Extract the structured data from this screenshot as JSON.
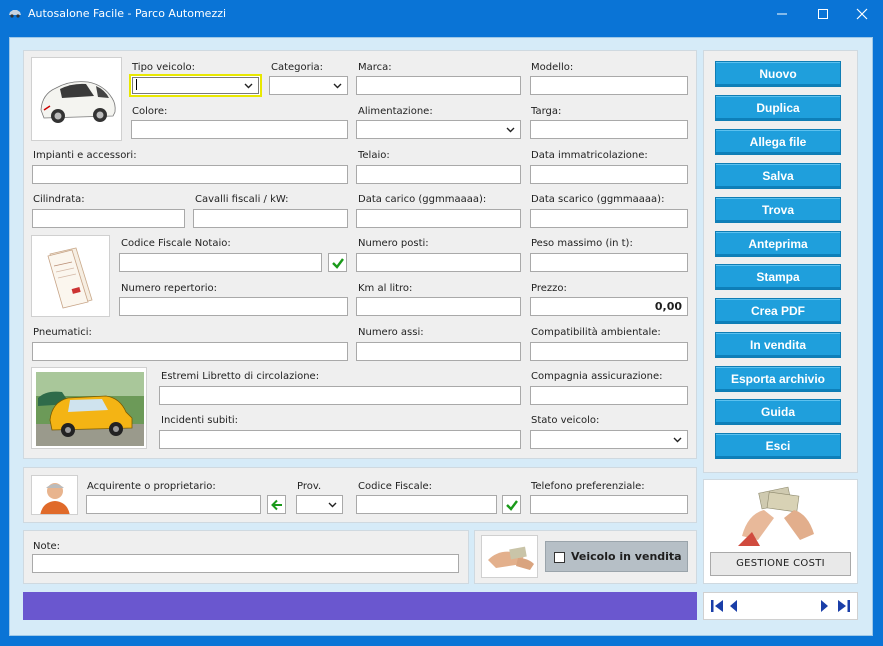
{
  "window": {
    "title": "Autosalone Facile - Parco Automezzi"
  },
  "vehicle": {
    "tipo_veicolo": {
      "label": "Tipo veicolo:",
      "value": ""
    },
    "categoria": {
      "label": "Categoria:",
      "value": ""
    },
    "marca": {
      "label": "Marca:",
      "value": ""
    },
    "modello": {
      "label": "Modello:",
      "value": ""
    },
    "colore": {
      "label": "Colore:",
      "value": ""
    },
    "alimentazione": {
      "label": "Alimentazione:",
      "value": ""
    },
    "targa": {
      "label": "Targa:",
      "value": ""
    },
    "impianti": {
      "label": "Impianti e accessori:",
      "value": ""
    },
    "telaio": {
      "label": "Telaio:",
      "value": ""
    },
    "data_immatricolazione": {
      "label": "Data immatricolazione:",
      "value": ""
    },
    "cilindrata": {
      "label": "Cilindrata:",
      "value": ""
    },
    "cavalli": {
      "label": "Cavalli fiscali / kW:",
      "value": ""
    },
    "data_carico": {
      "label": "Data carico (ggmmaaaa):",
      "value": ""
    },
    "data_scarico": {
      "label": "Data scarico (ggmmaaaa):",
      "value": ""
    },
    "cf_notaio": {
      "label": "Codice Fiscale Notaio:",
      "value": ""
    },
    "numero_posti": {
      "label": "Numero posti:",
      "value": ""
    },
    "peso_massimo": {
      "label": "Peso massimo (in t):",
      "value": ""
    },
    "numero_repertorio": {
      "label": "Numero repertorio:",
      "value": ""
    },
    "km_litro": {
      "label": "Km al litro:",
      "value": ""
    },
    "prezzo": {
      "label": "Prezzo:",
      "value": "0,00"
    },
    "pneumatici": {
      "label": "Pneumatici:",
      "value": ""
    },
    "numero_assi": {
      "label": "Numero assi:",
      "value": ""
    },
    "compatibilita": {
      "label": "Compatibilità ambientale:",
      "value": ""
    },
    "libretto": {
      "label": "Estremi Libretto di circolazione:",
      "value": ""
    },
    "compagnia": {
      "label": "Compagnia assicurazione:",
      "value": ""
    },
    "incidenti": {
      "label": "Incidenti subiti:",
      "value": ""
    },
    "stato": {
      "label": "Stato veicolo:",
      "value": ""
    }
  },
  "owner": {
    "acquirente": {
      "label": "Acquirente o proprietario:",
      "value": ""
    },
    "prov": {
      "label": "Prov.",
      "value": ""
    },
    "codice_fiscale": {
      "label": "Codice Fiscale:",
      "value": ""
    },
    "telefono": {
      "label": "Telefono preferenziale:",
      "value": ""
    }
  },
  "notes": {
    "label": "Note:",
    "value": ""
  },
  "vendita": {
    "label": "Veicolo in vendita",
    "checked": false
  },
  "sidebar": {
    "buttons": [
      "Nuovo",
      "Duplica",
      "Allega file",
      "Salva",
      "Trova",
      "Anteprima",
      "Stampa",
      "Crea PDF",
      "In vendita",
      "Esporta archivio",
      "Guida",
      "Esci"
    ]
  },
  "costs": {
    "button": "GESTIONE COSTI"
  },
  "colors": {
    "titlebar": "#0a74d6",
    "buttons": "#1f9fdc",
    "statusbar": "#6a57cf",
    "check": "#1a9a1a"
  }
}
